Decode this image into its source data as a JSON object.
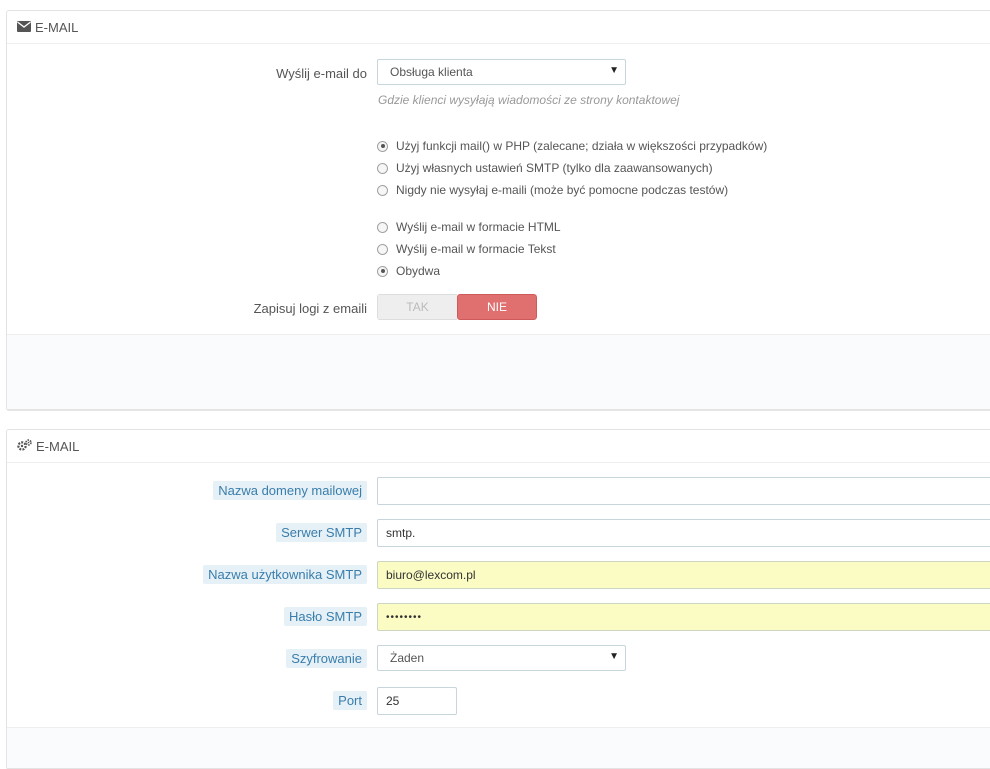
{
  "panel1": {
    "title": "E-MAIL",
    "send_to_label": "Wyślij e-mail do",
    "send_to_value": "Obsługa klienta",
    "send_to_help": "Gdzie klienci wysyłają wiadomości ze strony kontaktowej",
    "method_options": [
      {
        "label": "Użyj funkcji mail() w PHP (zalecane; działa w większości przypadków)",
        "checked": true
      },
      {
        "label": "Użyj własnych ustawień SMTP (tylko dla zaawansowanych)",
        "checked": false
      },
      {
        "label": "Nigdy nie wysyłaj e-maili (może być pomocne podczas testów)",
        "checked": false
      }
    ],
    "format_options": [
      {
        "label": "Wyślij e-mail w formacie HTML",
        "checked": false
      },
      {
        "label": "Wyślij e-mail w formacie Tekst",
        "checked": false
      },
      {
        "label": "Obydwa",
        "checked": true
      }
    ],
    "log_label": "Zapisuj logi z emaili",
    "toggle_yes": "TAK",
    "toggle_no": "NIE",
    "toggle_state": "NIE"
  },
  "panel2": {
    "title": "E-MAIL",
    "domain_label": "Nazwa domeny mailowej",
    "domain_value": "",
    "smtp_server_label": "Serwer SMTP",
    "smtp_server_value": "smtp.",
    "username_label": "Nazwa użytkownika SMTP",
    "username_value": "biuro@lexcom.pl",
    "password_label": "Hasło SMTP",
    "password_value": "••••••••",
    "encryption_label": "Szyfrowanie",
    "encryption_value": "Żaden",
    "port_label": "Port",
    "port_value": "25"
  },
  "colors": {
    "accent_red": "#e07070",
    "autofill_yellow": "#fbfcc4",
    "hint_blue_bg": "#e5f1f7"
  },
  "icons": {
    "panel1": "envelope-icon",
    "panel2": "cogs-icon"
  }
}
